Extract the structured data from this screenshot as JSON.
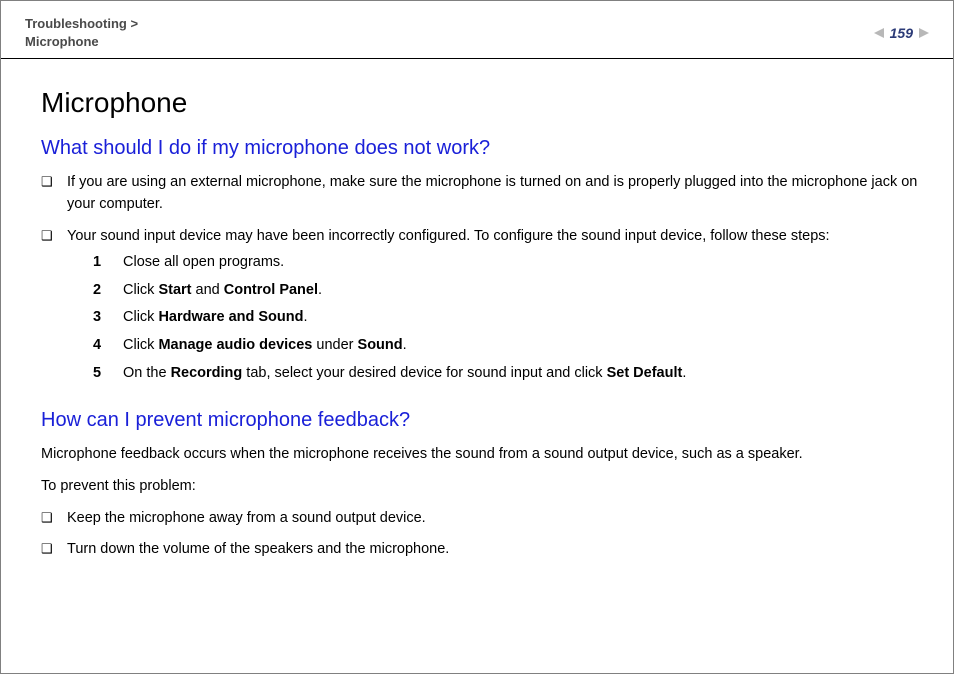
{
  "header": {
    "breadcrumb_category": "Troubleshooting",
    "breadcrumb_sep": " >",
    "breadcrumb_page": "Microphone",
    "page_number": "159"
  },
  "title": "Microphone",
  "section1": {
    "heading": "What should I do if my microphone does not work?",
    "bullet1": "If you are using an external microphone, make sure the microphone is turned on and is properly plugged into the microphone jack on your computer.",
    "bullet2": "Your sound input device may have been incorrectly configured. To configure the sound input device, follow these steps:",
    "steps": {
      "s1": {
        "n": "1",
        "t1": "Close all open programs."
      },
      "s2": {
        "n": "2",
        "t1": "Click ",
        "b1": "Start",
        "t2": " and ",
        "b2": "Control Panel",
        "t3": "."
      },
      "s3": {
        "n": "3",
        "t1": "Click ",
        "b1": "Hardware and Sound",
        "t2": "."
      },
      "s4": {
        "n": "4",
        "t1": "Click ",
        "b1": "Manage audio devices",
        "t2": " under ",
        "b2": "Sound",
        "t3": "."
      },
      "s5": {
        "n": "5",
        "t1": "On the ",
        "b1": "Recording",
        "t2": " tab, select your desired device for sound input and click ",
        "b2": "Set Default",
        "t3": "."
      }
    }
  },
  "section2": {
    "heading": "How can I prevent microphone feedback?",
    "para1": "Microphone feedback occurs when the microphone receives the sound from a sound output device, such as a speaker.",
    "para2": "To prevent this problem:",
    "bullet1": "Keep the microphone away from a sound output device.",
    "bullet2": "Turn down the volume of the speakers and the microphone."
  }
}
